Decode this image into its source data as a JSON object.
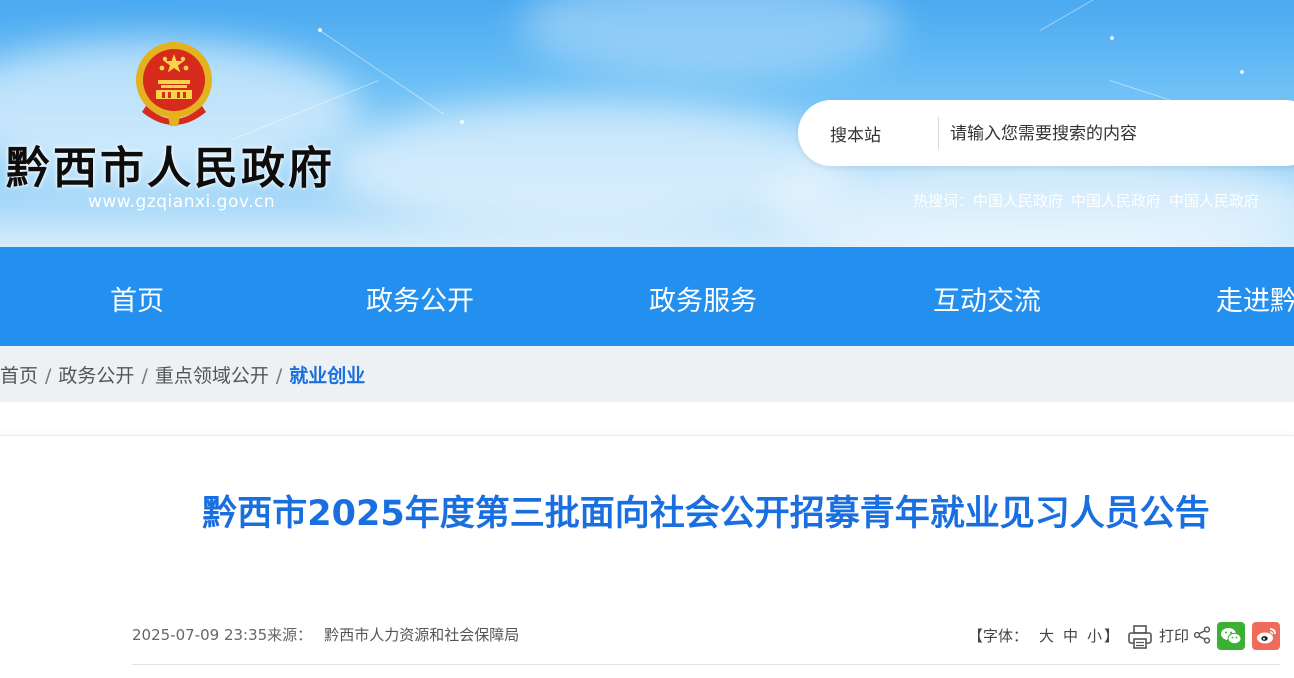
{
  "header": {
    "site_title": "黔西市人民政府",
    "site_url": "www.gzqianxi.gov.cn",
    "search": {
      "scope_label": "搜本站",
      "placeholder": "请输入您需要搜索的内容"
    },
    "hotwords_label": "热搜词：",
    "hotwords": [
      "中国人民政府",
      "中国人民政府",
      "中国人民政府"
    ]
  },
  "nav": {
    "items": [
      "首页",
      "政务公开",
      "政务服务",
      "互动交流",
      "走进黔西"
    ]
  },
  "breadcrumb": {
    "items": [
      "首页",
      "政务公开",
      "重点领域公开"
    ],
    "separator": "/",
    "current": "就业创业"
  },
  "article": {
    "title": "黔西市2025年度第三批面向社会公开招募青年就业见习人员公告",
    "date": "2025-07-09 23:35",
    "source_label": "来源：",
    "source": "黔西市人力资源和社会保障局",
    "font_size_label": "【字体：",
    "font_sizes": [
      "大",
      "中",
      "小"
    ],
    "font_size_close": "】",
    "print_label": "打印"
  },
  "colors": {
    "nav_bg": "#2390f0",
    "accent_blue": "#1a6fe0",
    "wechat": "#3cb034",
    "weibo": "#ef6b5c"
  }
}
